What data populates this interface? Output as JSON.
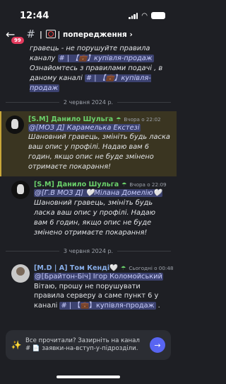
{
  "status": {
    "time": "12:44"
  },
  "header": {
    "badge": "99",
    "channel_name": "попередження",
    "chevron": "›",
    "icons": [
      "back-arrow-icon",
      "hash-icon",
      "no-entry-icon"
    ]
  },
  "top_message": {
    "line1": "гравець  - не порушуйте правила каналу",
    "channel_ref": "# | 【💼】купівля-продаж",
    "line2": " Ознайомтесь з правилами подачі , в",
    "line3": "даному каналі ",
    "channel_ref2": "# | 【💼】купівля-продаж"
  },
  "date1": "2 червня 2024 р.",
  "messages": [
    {
      "author": "[S.M] Данило Шульга",
      "tag": "☂",
      "time": "Вчора о 22:02",
      "mention": "@[МОЗ Д] Карамелька Екстезі",
      "text": " Шановний гравець, змініть будь ласка ваш опис у профілі. Надаю вам 6 годин, якщо опис не буде змінено отримаєте покарання!"
    },
    {
      "author": "[S.M] Данило Шульга",
      "tag": "☂",
      "time": "Вчора о 22:09",
      "mention": "@[Г.В МОЗ Д] 🤍Мілана Домелію🤍",
      "text": " Шановний гравець, змініть будь ласка ваш опис у профілі. Надаю вам 6 годин, якщо опис не буде змінено отримаєте покарання!"
    }
  ],
  "date2": "3 червня 2024 р.",
  "last_message": {
    "author": "[M.D | A] Том Кенді🤍",
    "tag": "☂",
    "time": "Сьогодні о 00:48",
    "mention": "@[Брайтон-Біч] Ігор Коломойський",
    "text1": " Вітаю, прошу не порушувати правила серверу а саме пункт 6 у каналі ",
    "channel_ref": "# | 【💼】купівля-продаж",
    "text2": " ."
  },
  "composer": {
    "text": "Все прочитали? Зазирніть на канал # 📄 заявки-на-вступ-у-підрозділи.",
    "send_icon": "arrow-right-icon"
  }
}
